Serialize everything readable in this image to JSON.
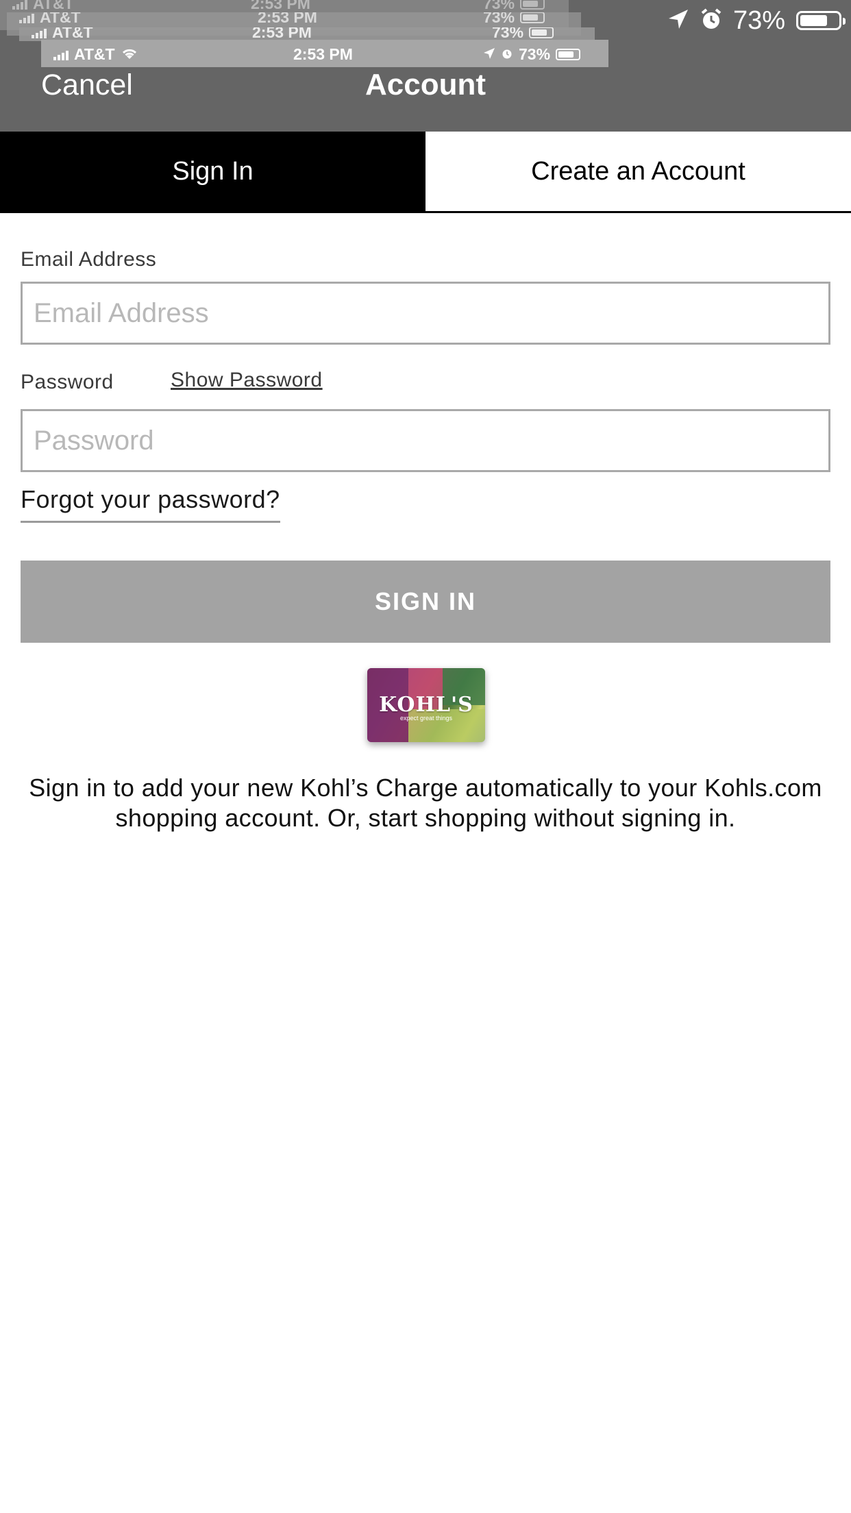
{
  "status_bar": {
    "battery_pct_text": "73%",
    "battery_level": 0.73,
    "carrier": "AT&T",
    "time": "2:53 PM",
    "ghost_battery_text": "73%",
    "ghost_partial_carrier": "AT&T",
    "ghost_partial_time": "2:53 PM",
    "ghost_partial_battery": "73%"
  },
  "header": {
    "cancel_label": "Cancel",
    "title": "Account"
  },
  "tabs": [
    {
      "label": "Sign In",
      "active": true
    },
    {
      "label": "Create an Account",
      "active": false
    }
  ],
  "form": {
    "email_label": "Email Address",
    "email_placeholder": "Email Address",
    "email_value": "",
    "password_label": "Password",
    "show_password_label": "Show Password",
    "password_placeholder": "Password",
    "password_value": "",
    "forgot_label": "Forgot your password?",
    "submit_label": "SIGN IN"
  },
  "card": {
    "brand": "KOHL'S",
    "tagline": "expect great things",
    "icon": "kohls-charge-card-icon"
  },
  "promo": {
    "text": "Sign in to add your new Kohl’s Charge automatically to your Kohls.com shopping account. Or, start shopping without signing in."
  },
  "colors": {
    "header_bg": "#656565",
    "tab_active_bg": "#000000",
    "button_disabled_bg": "#a3a3a3"
  }
}
